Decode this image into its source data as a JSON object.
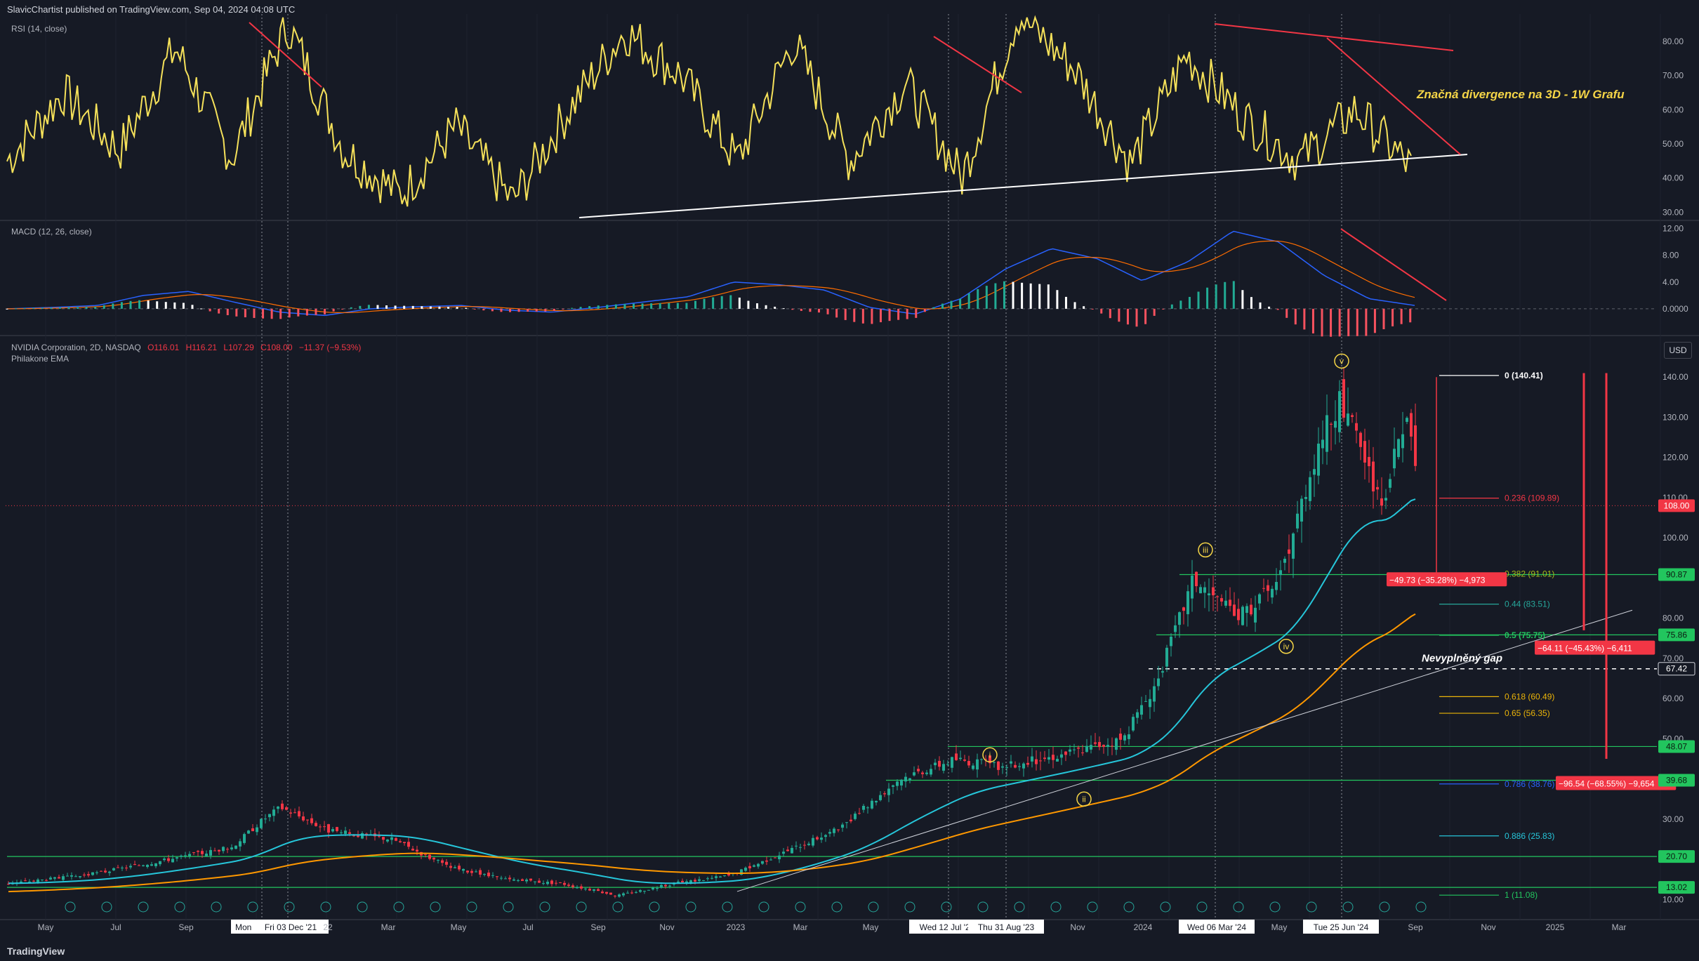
{
  "header": {
    "published": "SlavicChartist published on TradingView.com, Sep 04, 2024 04:08 UTC",
    "footer_brand": "TradingView",
    "currency": "USD"
  },
  "rsi": {
    "label": "RSI (14, close)",
    "axis_ticks": [
      "80.00",
      "70.00",
      "60.00",
      "50.00",
      "40.00",
      "30.00"
    ],
    "annotation": "Značná divergence na 3D - 1W Grafu"
  },
  "macd": {
    "label": "MACD (12, 26, close)",
    "axis_ticks": [
      "12.00",
      "8.00",
      "4.00",
      "0.0000"
    ]
  },
  "main": {
    "symbol": "NVIDIA Corporation, 2D, NASDAQ",
    "o": "O116.01",
    "h": "H116.21",
    "l": "L107.29",
    "c": "C108.00",
    "chg": "−11.37 (−9.53%)",
    "indicator": "Philakone EMA",
    "gap_label": "Nevyplněný gap",
    "price_ticks": [
      "140.00",
      "130.00",
      "120.00",
      "110.00",
      "100.00",
      "90.00",
      "80.00",
      "70.00",
      "60.00",
      "50.00",
      "40.00",
      "30.00",
      "20.00",
      "10.00"
    ],
    "fib_levels": [
      "0 (140.41)",
      "0.236 (109.89)",
      "0.382 (91.01)",
      "0.44 (83.51)",
      "0.5 (75.75)",
      "0.618 (60.49)",
      "0.65 (56.35)",
      "0.786 (38.76)",
      "0.886 (25.83)",
      "1 (11.08)"
    ],
    "price_badges": [
      "108.00",
      "90.87",
      "75.86",
      "67.42",
      "48.07",
      "39.68",
      "20.70",
      "13.02"
    ],
    "measures": [
      "−49.73 (−35.28%) −4,973",
      "−64.11 (−45.43%) −6,411",
      "−96.54 (−68.55%) −9,654"
    ],
    "waves": [
      "i",
      "ii",
      "iii",
      "iv",
      "v"
    ]
  },
  "time_axis": {
    "labels": [
      "May",
      "Jul",
      "Sep",
      "Mon 08",
      "Fri 03 Dec '21",
      "22",
      "Mar",
      "May",
      "Jul",
      "Sep",
      "Nov",
      "2023",
      "Mar",
      "May",
      "Wed 12 Jul '23",
      "Thu 31 Aug '23",
      "Nov",
      "2024",
      "Wed 06 Mar '24",
      "May",
      "Tue 25 Jun '24",
      "Sep",
      "Nov",
      "2025",
      "Mar"
    ]
  },
  "chart_data": {
    "type": "candlestick",
    "title": "NVIDIA Corporation, 2D, NASDAQ",
    "ylabel": "USD",
    "ylim": [
      5,
      150
    ],
    "series": [
      {
        "name": "close",
        "x": [
          "2021-05",
          "2021-09",
          "2021-11",
          "2022-01",
          "2022-06",
          "2022-10",
          "2023-01",
          "2023-05",
          "2023-08",
          "2024-01",
          "2024-03",
          "2024-06",
          "2024-08",
          "2024-09"
        ],
        "values": [
          15,
          22,
          33,
          27,
          17,
          11,
          15,
          30,
          47,
          50,
          90,
          135,
          123,
          108
        ]
      }
    ],
    "rsi_values": [
      45,
      65,
      48,
      78,
      46,
      85,
      48,
      35,
      55,
      33,
      60,
      83,
      70,
      45,
      80,
      45,
      68,
      40,
      88,
      72,
      44,
      76,
      58,
      45,
      60,
      43
    ],
    "macd_last": 0.0
  }
}
